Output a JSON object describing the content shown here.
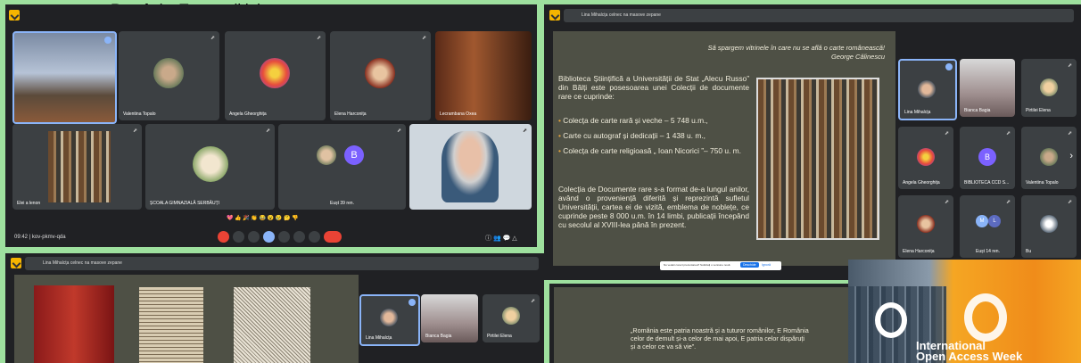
{
  "caption": "România. Tema ediției",
  "panel_tl": {
    "participants": [
      "Valentina Topalo",
      "Angela Gheorghița",
      "Elena Harconița",
      "Lecrambana Oxea",
      "ȘCOALA GIMNAZIALĂ SERBĂUȚI",
      "Elei a lenon",
      "Eușt 39 ren."
    ],
    "avatar_letter": "B",
    "time": "09:42",
    "meeting_code": "kov-pkmv-qda",
    "reactions": "💖 👍 🎉 👏 😂 😮 😢 🤔 👎"
  },
  "panel_tr": {
    "share_title": "Lina Mihalcța celnec na masove zepane",
    "quote": "Să spargem vitrinele în care nu se află o carte românească!",
    "quote_author": "George Călinescu",
    "intro": "Biblioteca Științifică a Universității de Stat „Alecu Russo” din Bălți este posesoarea unei Colecții de documente rare ce cuprinde:",
    "bullets": [
      "Colecța de carte rară și veche – 5 748 u.m.,",
      "Carte cu autograf și dedicații – 1 438 u. m.,",
      "Colecța de carte religioasă „ Ioan Nicorici ”– 750 u. m."
    ],
    "body": "Colecția de Documente rare s-a format de-a lungul anilor, având o proveniență diferită și reprezintă sufletul Universității, cartea ei de vizită, emblema de noblețe, ce cuprinde peste 8 000 u.m. în 14 limbi, publicații începând cu secolul al XVIII-lea până în prezent.",
    "participants": [
      "Lina Mihalcța",
      "Bianca Bagia",
      "Pirtilei Elena",
      "Angela Gheorghița",
      "BIBLIOTECA CCD S...",
      "Valentina Topalo",
      "Elena Harconița",
      "Eușt 14 ren.",
      "Bu"
    ],
    "badge_b": "B",
    "badge_m": "M",
    "badge_l": "L",
    "notice": "Nu vedeti corect prezentarea? Solicitați o versiune nouă",
    "notice_btn": "Deschide",
    "notice_link": "Ignoră"
  },
  "panel_bl": {
    "share_title": "Lina Mihalcța celnec na masove zepane",
    "participants": [
      "Lina Mihalcța",
      "Bianca Bagia",
      "Pirtilei Elena"
    ]
  },
  "panel_br": {
    "poem": "„România este patria noastră și a tuturor românilor, E România celor de demult și-a celor de mai apoi, E patria celor dispăruți și a celor ce va să vie”.",
    "banner_line1": "International",
    "banner_line2": "Open Access Week"
  }
}
